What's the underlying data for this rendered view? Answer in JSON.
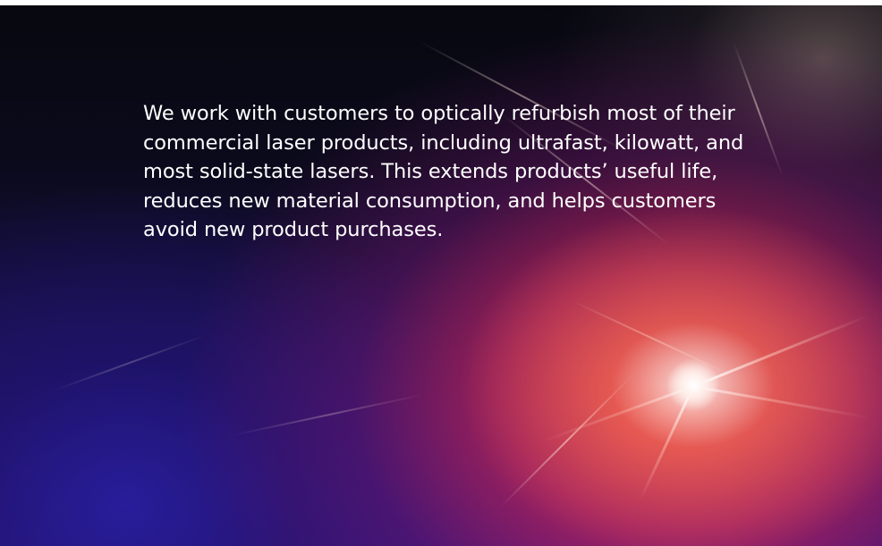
{
  "hero": {
    "background_icon": "laser-light-burst-image",
    "accent_colors": [
      "#07080f",
      "#2c1370",
      "#ff463c",
      "#ffffff"
    ],
    "text": "We work with customers to optically refurbish most of their commercial laser products, including ultrafast, kilowatt, and most solid-state lasers. This extends products’ useful life, reduces new material consumption, and helps customers avoid new product purchases."
  }
}
